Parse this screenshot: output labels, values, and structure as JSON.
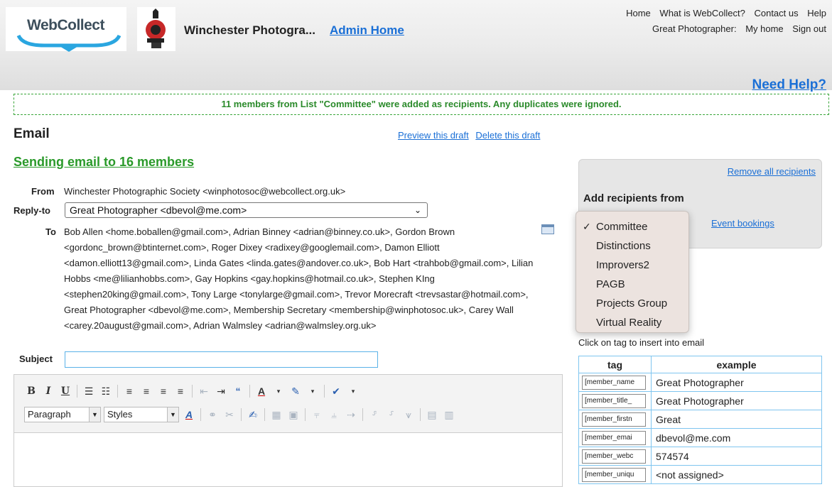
{
  "header": {
    "logo_text": "WebCollect",
    "club_name": "Winchester Photogra...",
    "admin_home": "Admin Home",
    "nav": [
      "Home",
      "What is WebCollect?",
      "Contact us",
      "Help"
    ],
    "user_name": "Great Photographer:",
    "my_home": "My home",
    "sign_out": "Sign out",
    "need_help": "Need Help?"
  },
  "notice": "11 members from List \"Committee\" were added as recipients. Any duplicates were ignored.",
  "page": {
    "title": "Email",
    "preview_link": "Preview this draft",
    "delete_link": "Delete this draft",
    "sending": "Sending email to 16 members"
  },
  "form": {
    "from_label": "From",
    "from_value": "Winchester Photographic Society <winphotosoc@webcollect.org.uk>",
    "reply_label": "Reply-to",
    "reply_value": "Great Photographer <dbevol@me.com>",
    "to_label": "To",
    "to_value": "Bob Allen <home.boballen@gmail.com>, Adrian Binney <adrian@binney.co.uk>, Gordon Brown <gordonc_brown@btinternet.com>, Roger Dixey <radixey@googlemail.com>, Damon Elliott <damon.elliott13@gmail.com>, Linda Gates <linda.gates@andover.co.uk>, Bob Hart <trahbob@gmail.com>, Lilian Hobbs <me@lilianhobbs.com>, Gay Hopkins <gay.hopkins@hotmail.co.uk>, Stephen KIng <stephen20king@gmail.com>, Tony Large <tonylarge@gmail.com>, Trevor Morecraft <trevsastar@hotmail.com>, Great Photographer <dbevol@me.com>, Membership Secretary <membership@winphotosoc.uk>, Carey Wall <carey.20august@gmail.com>, Adrian Walmsley <adrian@walmsley.org.uk>",
    "subject_label": "Subject",
    "subject_value": ""
  },
  "editor": {
    "format_select": "Paragraph",
    "styles_select": "Styles"
  },
  "panel": {
    "remove_all": "Remove all recipients",
    "add_from": "Add recipients from",
    "event_bookings": "Event bookings",
    "dropdown": [
      "Committee",
      "Distinctions",
      "Improvers2",
      "PAGB",
      "Projects Group",
      "Virtual Reality"
    ],
    "dropdown_checked": "Committee"
  },
  "tags": {
    "instruction": "Click on tag to insert into email",
    "col_tag": "tag",
    "col_example": "example",
    "rows": [
      {
        "tag": "[member_name",
        "example": "Great Photographer"
      },
      {
        "tag": "[member_title_",
        "example": "Great Photographer"
      },
      {
        "tag": "[member_firstn",
        "example": "Great"
      },
      {
        "tag": "[member_emai",
        "example": "dbevol@me.com"
      },
      {
        "tag": "[member_webc",
        "example": "574574"
      },
      {
        "tag": "[member_uniqu",
        "example": "<not assigned>"
      }
    ]
  }
}
